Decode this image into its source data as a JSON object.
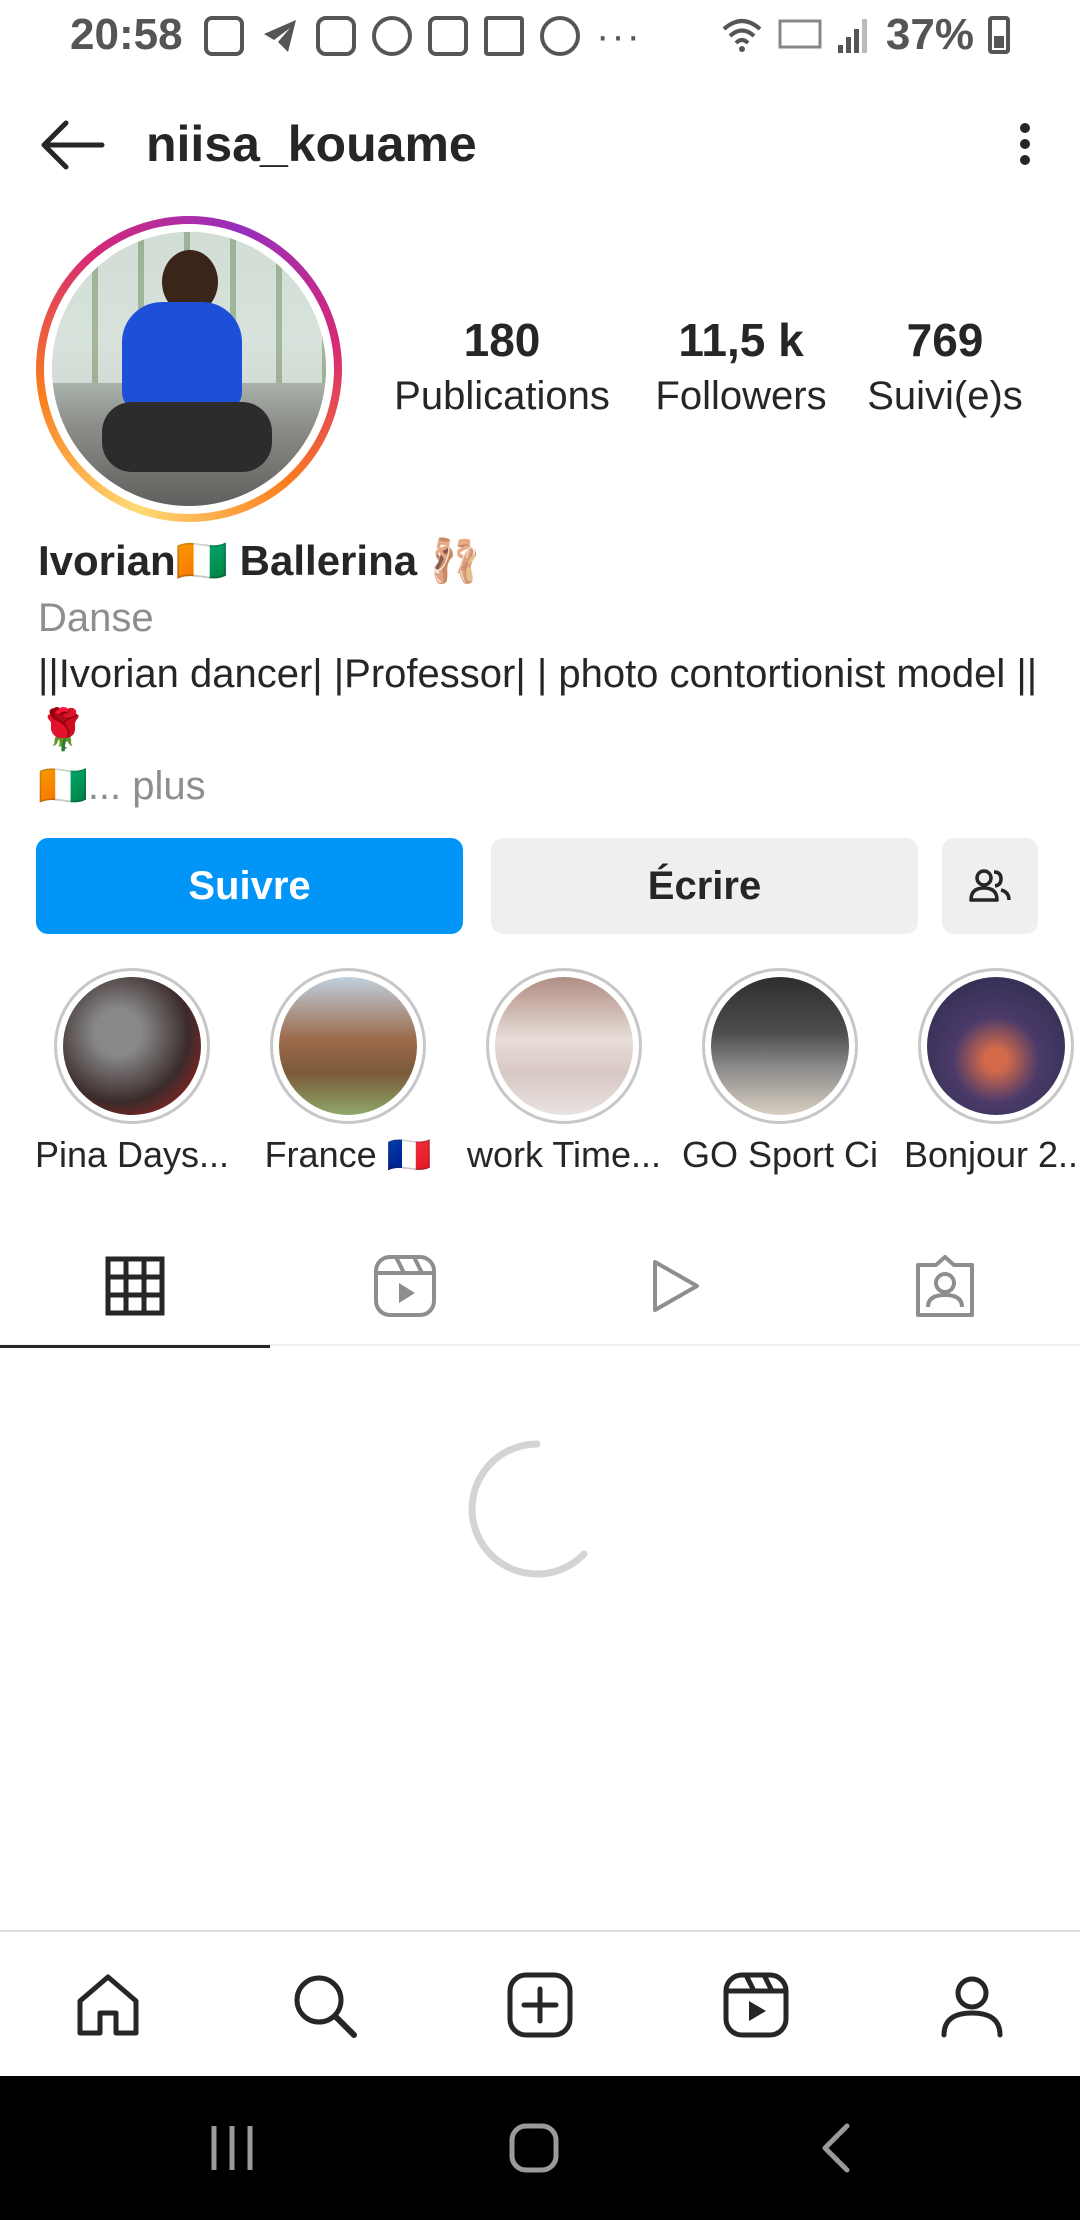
{
  "status_bar": {
    "time": "20:58",
    "battery": "37%",
    "notification_icons": [
      "pocket-icon",
      "telegram-icon",
      "instagram-icon",
      "facebook-icon",
      "pocket-icon",
      "gallery-icon",
      "whatsapp-icon"
    ],
    "overflow": "···"
  },
  "header": {
    "username": "niisa_kouame"
  },
  "stats": {
    "posts_value": "180",
    "posts_label": "Publications",
    "followers_value": "11,5 k",
    "followers_label": "Followers",
    "following_value": "769",
    "following_label": "Suivi(e)s"
  },
  "bio": {
    "name": "Ivorian🇨🇮 Ballerina 🩰",
    "category": "Danse",
    "text": "||Ivorian dancer| |Professor| | photo contortionist model || 🌹",
    "flag": "🇨🇮",
    "more": "... plus"
  },
  "actions": {
    "follow": "Suivre",
    "message": "Écrire"
  },
  "highlights": [
    {
      "label": "Pina Days...",
      "color": "#3b2b2b"
    },
    {
      "label": "France 🇫🇷",
      "color": "#9c6b4a"
    },
    {
      "label": "work Time...",
      "color": "#e8ddd8"
    },
    {
      "label": "GO Sport Ci",
      "color": "#4d4d4d"
    },
    {
      "label": "Bonjour  2...",
      "color": "#2a2a48"
    }
  ],
  "tabs": [
    "grid-icon",
    "reels-icon",
    "video-icon",
    "tagged-icon"
  ],
  "colors": {
    "follow_button": "#0095f6",
    "secondary_button": "#efefef",
    "text": "#262626",
    "muted": "#8e8e8e"
  }
}
